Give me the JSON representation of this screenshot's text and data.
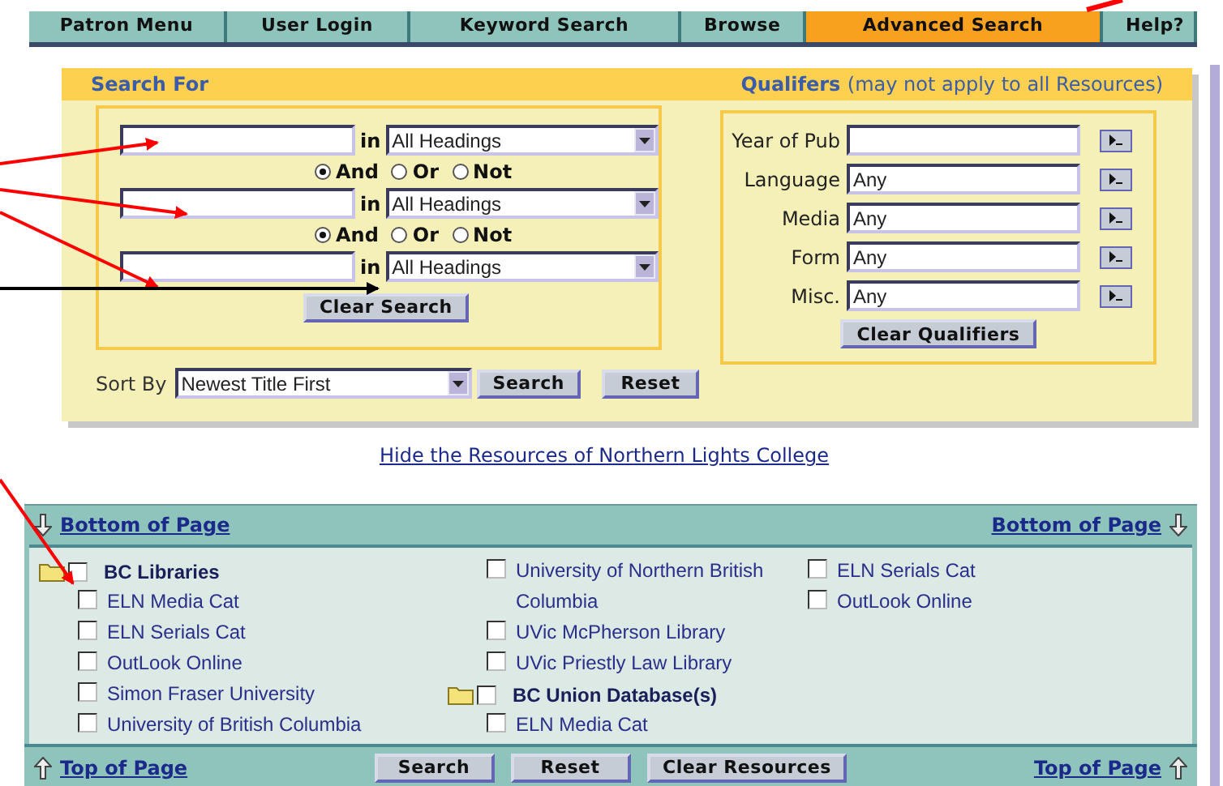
{
  "nav": [
    {
      "label": "Patron Menu",
      "selected": false
    },
    {
      "label": "User Login",
      "selected": false
    },
    {
      "label": "Keyword Search",
      "selected": false
    },
    {
      "label": "Browse",
      "selected": false
    },
    {
      "label": "Advanced Search",
      "selected": true
    },
    {
      "label": "Help?",
      "selected": false
    }
  ],
  "search_for": {
    "title": "Search For",
    "rows": [
      {
        "value": "",
        "in_label": "in",
        "field": "All Headings"
      },
      {
        "value": "",
        "in_label": "in",
        "field": "All Headings"
      },
      {
        "value": "",
        "in_label": "in",
        "field": "All Headings"
      }
    ],
    "operators": [
      [
        {
          "label": "And",
          "selected": true
        },
        {
          "label": "Or",
          "selected": false
        },
        {
          "label": "Not",
          "selected": false
        }
      ],
      [
        {
          "label": "And",
          "selected": true
        },
        {
          "label": "Or",
          "selected": false
        },
        {
          "label": "Not",
          "selected": false
        }
      ]
    ],
    "clear_button": "Clear Search"
  },
  "qualifiers": {
    "title": "Qualifers",
    "note": "(may not apply to all Resources)",
    "rows": [
      {
        "label": "Year of Pub",
        "value": ""
      },
      {
        "label": "Language",
        "value": "Any"
      },
      {
        "label": "Media",
        "value": "Any"
      },
      {
        "label": "Form",
        "value": "Any"
      },
      {
        "label": "Misc.",
        "value": "Any"
      }
    ],
    "clear_button": "Clear Qualifiers"
  },
  "sort": {
    "label": "Sort By",
    "value": "Newest Title First",
    "search_button": "Search",
    "reset_button": "Reset"
  },
  "hide_link": "Hide the Resources of Northern Lights College",
  "resources": {
    "top_left_link": "Bottom of Page",
    "top_right_link": "Bottom of Page",
    "columns": [
      [
        {
          "kind": "group",
          "label": "BC Libraries",
          "checked": false,
          "children": [
            {
              "label": "ELN Media Cat",
              "checked": false
            },
            {
              "label": "ELN Serials Cat",
              "checked": false
            },
            {
              "label": "OutLook Online",
              "checked": false
            },
            {
              "label": "Simon Fraser University",
              "checked": false
            },
            {
              "label": "University of British Columbia",
              "checked": false
            }
          ]
        }
      ],
      [
        {
          "kind": "item",
          "label": "University of Northern British Columbia",
          "checked": false
        },
        {
          "kind": "item",
          "label": "UVic McPherson Library",
          "checked": false
        },
        {
          "kind": "item",
          "label": "UVic Priestly Law Library",
          "checked": false
        },
        {
          "kind": "group",
          "label": "BC Union Database(s)",
          "checked": false,
          "children": [
            {
              "label": "ELN Media Cat",
              "checked": false
            }
          ]
        }
      ],
      [
        {
          "kind": "item",
          "label": "ELN Serials Cat",
          "checked": false
        },
        {
          "kind": "item",
          "label": "OutLook Online",
          "checked": false
        }
      ]
    ],
    "bottom_left_link": "Top of Page",
    "search_button": "Search",
    "reset_button": "Reset",
    "clear_button": "Clear Resources",
    "bottom_right_link": "Top of Page"
  }
}
